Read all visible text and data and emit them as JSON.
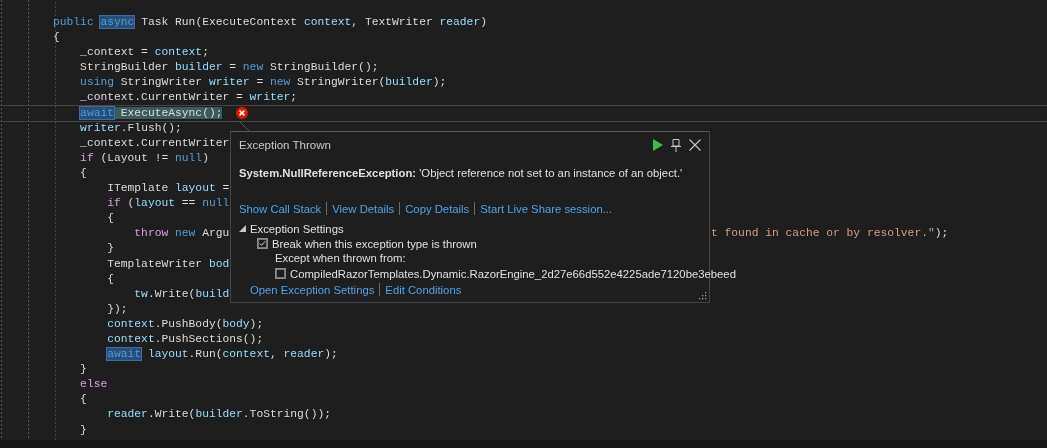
{
  "editor": {
    "lines": [
      {
        "current": false,
        "error": false,
        "tokens": [
          {
            "kind": "keyword",
            "text": "public",
            "highlighted": false
          },
          {
            "kind": "keyword",
            "text": "async",
            "highlighted": true
          },
          {
            "kind": "plain",
            "text": "Task Run(ExecuteContext",
            "highlighted": false
          },
          {
            "kind": "variable",
            "text": "context",
            "highlighted": false
          },
          {
            "kind": "plain",
            "text": ", TextWriter",
            "highlighted": false
          },
          {
            "kind": "variable",
            "text": "reader",
            "highlighted": false
          },
          {
            "kind": "plain",
            "text": ")",
            "highlighted": false
          }
        ]
      },
      {
        "current": false,
        "error": false,
        "tokens": [
          {
            "kind": "plain",
            "text": "{",
            "highlighted": false
          }
        ]
      },
      {
        "current": false,
        "error": false,
        "tokens": [
          {
            "kind": "plain",
            "text": "    _context = ",
            "highlighted": false
          },
          {
            "kind": "variable",
            "text": "context",
            "highlighted": false
          },
          {
            "kind": "plain",
            "text": ";",
            "highlighted": false
          }
        ]
      },
      {
        "current": false,
        "error": false,
        "tokens": [
          {
            "kind": "plain",
            "text": "    StringBuilder ",
            "highlighted": false
          },
          {
            "kind": "variable",
            "text": "builder",
            "highlighted": false
          },
          {
            "kind": "plain",
            "text": " = ",
            "highlighted": false
          },
          {
            "kind": "keyword",
            "text": "new",
            "highlighted": false
          },
          {
            "kind": "plain",
            "text": " StringBuilder();",
            "highlighted": false
          }
        ]
      },
      {
        "current": false,
        "error": false,
        "tokens": [
          {
            "kind": "keyword",
            "text": "    using",
            "highlighted": false
          },
          {
            "kind": "plain",
            "text": " StringWriter ",
            "highlighted": false
          },
          {
            "kind": "variable",
            "text": "writer",
            "highlighted": false
          },
          {
            "kind": "plain",
            "text": " = ",
            "highlighted": false
          },
          {
            "kind": "keyword",
            "text": "new",
            "highlighted": false
          },
          {
            "kind": "plain",
            "text": " StringWriter(",
            "highlighted": false
          },
          {
            "kind": "variable",
            "text": "builder",
            "highlighted": false
          },
          {
            "kind": "plain",
            "text": ");",
            "highlighted": false
          }
        ]
      },
      {
        "current": false,
        "error": false,
        "tokens": [
          {
            "kind": "plain",
            "text": "    _context.CurrentWriter = ",
            "highlighted": false
          },
          {
            "kind": "variable",
            "text": "writer",
            "highlighted": false
          },
          {
            "kind": "plain",
            "text": ";",
            "highlighted": false
          }
        ]
      },
      {
        "current": true,
        "error": true,
        "tokens": [
          {
            "kind": "keyword",
            "text": "    await",
            "highlighted": true
          },
          {
            "kind": "plain",
            "text": " ExecuteAsync();",
            "highlighted": true
          }
        ]
      },
      {
        "current": false,
        "error": false,
        "tokens": [
          {
            "kind": "variable",
            "text": "    writer",
            "highlighted": false
          },
          {
            "kind": "plain",
            "text": ".Flush();",
            "highlighted": false
          }
        ]
      },
      {
        "current": false,
        "error": false,
        "tokens": [
          {
            "kind": "plain",
            "text": "    _context.CurrentWriter",
            "highlighted": false
          }
        ]
      },
      {
        "current": false,
        "error": false,
        "tokens": [
          {
            "kind": "control",
            "text": "    if",
            "highlighted": false
          },
          {
            "kind": "plain",
            "text": " (Layout != ",
            "highlighted": false
          },
          {
            "kind": "keyword",
            "text": "null",
            "highlighted": false
          },
          {
            "kind": "plain",
            "text": ")",
            "highlighted": false
          }
        ]
      },
      {
        "current": false,
        "error": false,
        "tokens": [
          {
            "kind": "plain",
            "text": "    {",
            "highlighted": false
          }
        ]
      },
      {
        "current": false,
        "error": false,
        "tokens": [
          {
            "kind": "plain",
            "text": "        ITemplate ",
            "highlighted": false
          },
          {
            "kind": "variable",
            "text": "layout",
            "highlighted": false
          },
          {
            "kind": "plain",
            "text": " =",
            "highlighted": false
          }
        ]
      },
      {
        "current": false,
        "error": false,
        "tokens": [
          {
            "kind": "control",
            "text": "        if",
            "highlighted": false
          },
          {
            "kind": "plain",
            "text": " (",
            "highlighted": false
          },
          {
            "kind": "variable",
            "text": "layout",
            "highlighted": false
          },
          {
            "kind": "plain",
            "text": " == ",
            "highlighted": false
          },
          {
            "kind": "keyword",
            "text": "null",
            "highlighted": false
          }
        ]
      },
      {
        "current": false,
        "error": false,
        "tokens": [
          {
            "kind": "plain",
            "text": "        {",
            "highlighted": false
          }
        ]
      },
      {
        "current": false,
        "error": false,
        "tokens": [
          {
            "kind": "control",
            "text": "            throw",
            "highlighted": false
          },
          {
            "kind": "keyword",
            "text": " new",
            "highlighted": false
          },
          {
            "kind": "plain",
            "text": " Argu",
            "highlighted": false
          }
        ],
        "tail": [
          {
            "kind": "string",
            "text": "t found in cache or by resolver.\"",
            "highlighted": false
          },
          {
            "kind": "plain",
            "text": ");",
            "highlighted": false
          }
        ]
      },
      {
        "current": false,
        "error": false,
        "tokens": [
          {
            "kind": "plain",
            "text": "        }",
            "highlighted": false
          }
        ]
      },
      {
        "current": false,
        "error": false,
        "tokens": [
          {
            "kind": "plain",
            "text": "        TemplateWriter ",
            "highlighted": false
          },
          {
            "kind": "variable",
            "text": "bod",
            "highlighted": false
          }
        ]
      },
      {
        "current": false,
        "error": false,
        "tokens": [
          {
            "kind": "plain",
            "text": "        {",
            "highlighted": false
          }
        ]
      },
      {
        "current": false,
        "error": false,
        "tokens": [
          {
            "kind": "variable",
            "text": "            tw",
            "highlighted": false
          },
          {
            "kind": "plain",
            "text": ".Write(",
            "highlighted": false
          },
          {
            "kind": "variable",
            "text": "build",
            "highlighted": false
          }
        ]
      },
      {
        "current": false,
        "error": false,
        "tokens": [
          {
            "kind": "plain",
            "text": "        });",
            "highlighted": false
          }
        ]
      },
      {
        "current": false,
        "error": false,
        "tokens": [
          {
            "kind": "variable",
            "text": "        context",
            "highlighted": false
          },
          {
            "kind": "plain",
            "text": ".PushBody(",
            "highlighted": false
          },
          {
            "kind": "variable",
            "text": "body",
            "highlighted": false
          },
          {
            "kind": "plain",
            "text": ");",
            "highlighted": false
          }
        ]
      },
      {
        "current": false,
        "error": false,
        "tokens": [
          {
            "kind": "variable",
            "text": "        context",
            "highlighted": false
          },
          {
            "kind": "plain",
            "text": ".PushSections();",
            "highlighted": false
          }
        ]
      },
      {
        "current": false,
        "error": false,
        "tokens": [
          {
            "kind": "keyword",
            "text": "        await",
            "highlighted": true
          },
          {
            "kind": "variable",
            "text": " layout",
            "highlighted": false
          },
          {
            "kind": "plain",
            "text": ".Run(",
            "highlighted": false
          },
          {
            "kind": "variable",
            "text": "context",
            "highlighted": false
          },
          {
            "kind": "plain",
            "text": ", ",
            "highlighted": false
          },
          {
            "kind": "variable",
            "text": "reader",
            "highlighted": false
          },
          {
            "kind": "plain",
            "text": ");",
            "highlighted": false
          }
        ]
      },
      {
        "current": false,
        "error": false,
        "tokens": [
          {
            "kind": "plain",
            "text": "    }",
            "highlighted": false
          }
        ]
      },
      {
        "current": false,
        "error": false,
        "tokens": [
          {
            "kind": "control",
            "text": "    else",
            "highlighted": false
          }
        ]
      },
      {
        "current": false,
        "error": false,
        "tokens": [
          {
            "kind": "plain",
            "text": "    {",
            "highlighted": false
          }
        ]
      },
      {
        "current": false,
        "error": false,
        "tokens": [
          {
            "kind": "variable",
            "text": "        reader",
            "highlighted": false
          },
          {
            "kind": "plain",
            "text": ".Write(",
            "highlighted": false
          },
          {
            "kind": "variable",
            "text": "builder",
            "highlighted": false
          },
          {
            "kind": "plain",
            "text": ".ToString());",
            "highlighted": false
          }
        ]
      },
      {
        "current": false,
        "error": false,
        "tokens": [
          {
            "kind": "plain",
            "text": "    }",
            "highlighted": false
          }
        ]
      }
    ]
  },
  "exception_popup": {
    "title": "Exception Thrown",
    "message": "**System.NullReferenceException:** 'Object reference not set to an instance of an object.'",
    "links": [
      "Show Call Stack",
      "View Details",
      "Copy Details",
      "Start Live Share session..."
    ],
    "settings": {
      "label": "Exception Settings",
      "expanded": true,
      "break_option": {
        "label": "Break when this exception type is thrown",
        "checked": true
      },
      "except_label": "Except when thrown from:",
      "except_items": [
        {
          "label": "CompiledRazorTemplates.Dynamic.RazorEngine_2d27e66d552e4225ade7120be3ebeed",
          "checked": false
        }
      ]
    },
    "footer_links": [
      "Open Exception Settings",
      "Edit Conditions"
    ]
  }
}
